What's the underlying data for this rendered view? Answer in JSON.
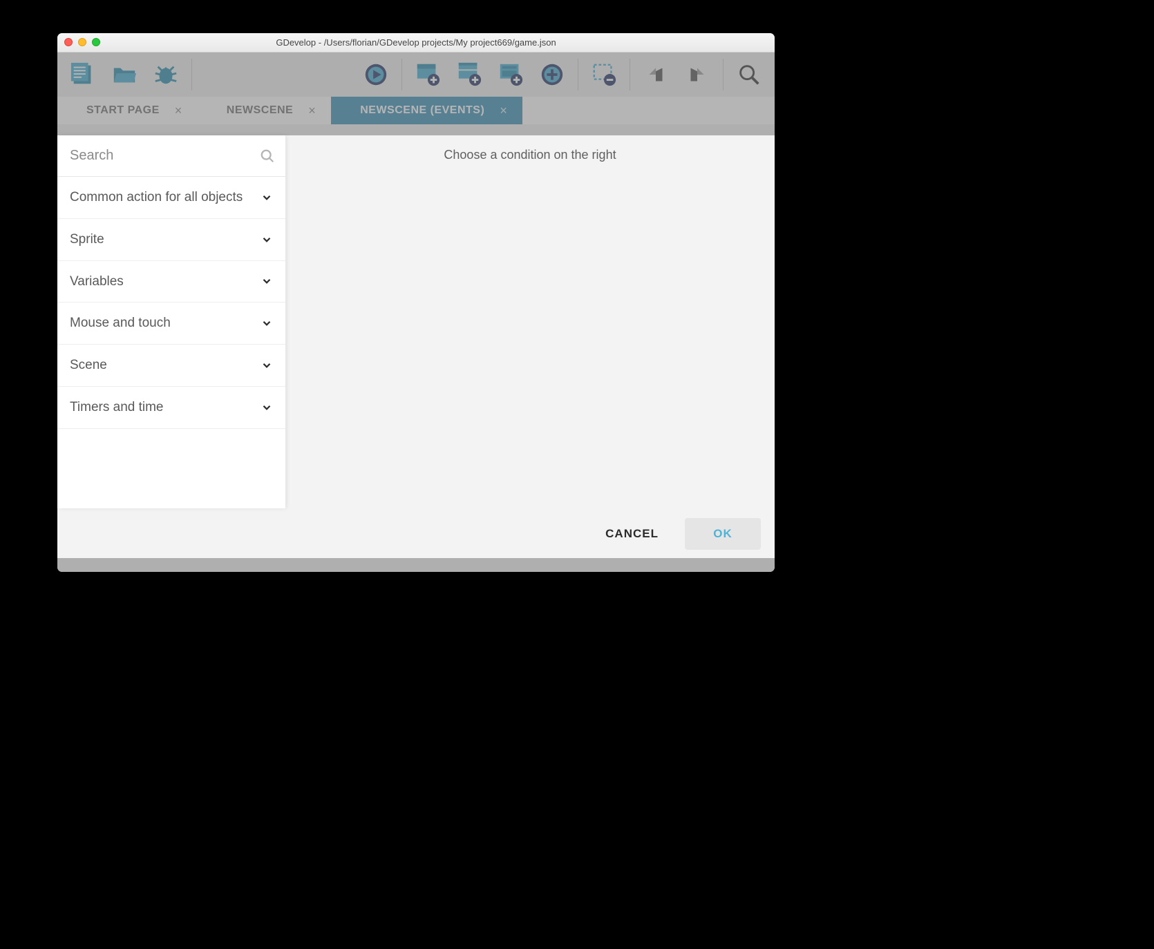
{
  "titlebar": {
    "title": "GDevelop - /Users/florian/GDevelop projects/My project669/game.json"
  },
  "tabs": [
    {
      "label": "START PAGE",
      "active": false
    },
    {
      "label": "NEWSCENE",
      "active": false
    },
    {
      "label": "NEWSCENE (EVENTS)",
      "active": true
    }
  ],
  "toolbar_icons": [
    "project-manager-icon",
    "open-folder-icon",
    "debug-icon",
    "sep",
    "spacer",
    "play-icon",
    "sep",
    "add-layer-icon",
    "add-group-icon",
    "add-panel-icon",
    "add-circle-icon",
    "sep",
    "delete-layer-icon",
    "sep",
    "undo-icon",
    "redo-icon",
    "sep",
    "search-icon"
  ],
  "modal": {
    "search_placeholder": "Search",
    "categories": [
      "Common action for all objects",
      "Sprite",
      "Variables",
      "Mouse and touch",
      "Scene",
      "Timers and time"
    ],
    "prompt": "Choose a condition on the right",
    "buttons": {
      "cancel": "CANCEL",
      "ok": "OK"
    }
  }
}
